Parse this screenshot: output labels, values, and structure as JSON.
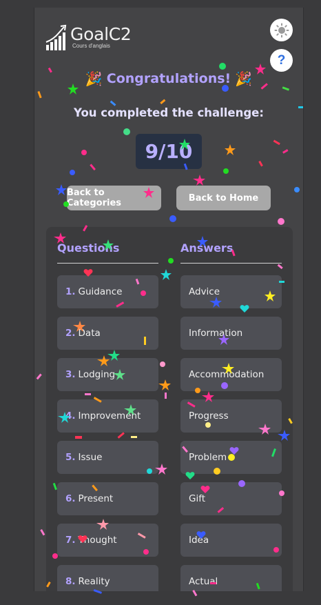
{
  "header": {
    "app_name": "GoalC2",
    "app_subtitle": "Cours d'anglais",
    "theme_icon": "sun-icon",
    "help_label": "?"
  },
  "result": {
    "title": "Congratulations!",
    "party_icon": "🎉",
    "message": "You completed the challenge:",
    "score": "9/10"
  },
  "actions": {
    "back_categories": "Back to Categories",
    "back_home": "Back to Home"
  },
  "review": {
    "questions_heading": "Questions",
    "answers_heading": "Answers",
    "rows": [
      {
        "num": "1.",
        "question": "Guidance",
        "answer": "Advice"
      },
      {
        "num": "2.",
        "question": "Data",
        "answer": "Information"
      },
      {
        "num": "3.",
        "question": "Lodging",
        "answer": "Accommodation"
      },
      {
        "num": "4.",
        "question": "Improvement",
        "answer": "Progress"
      },
      {
        "num": "5.",
        "question": "Issue",
        "answer": "Problem"
      },
      {
        "num": "6.",
        "question": "Present",
        "answer": "Gift"
      },
      {
        "num": "7.",
        "question": "Thought",
        "answer": "Idea"
      },
      {
        "num": "8.",
        "question": "Reality",
        "answer": "Actual"
      }
    ]
  },
  "colors": {
    "accent": "#b2a2ff",
    "background": "#444446",
    "score_bg": "#273143",
    "button": "#a8a8a8"
  }
}
